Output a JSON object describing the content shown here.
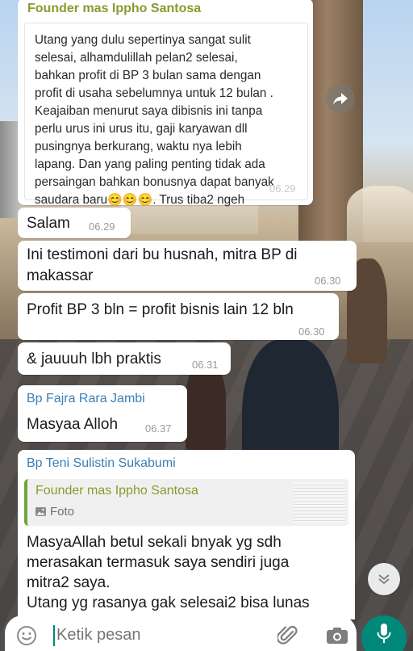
{
  "msg1": {
    "sender": "Founder mas Ippho Santosa",
    "lines": [
      "Utang yang dulu sepertinya sangat sulit",
      "selesai, alhamdulillah pelan2 selesai,",
      "bahkan profit di BP 3 bulan sama dengan",
      "profit di usaha sebelumnya untuk 12 bulan .",
      "Keajaiban menurut saya dibisnis ini tanpa",
      "perlu urus ini urus itu, gaji karyawan  dll",
      "pusingnya berkurang, waktu nya lebih",
      "lapang. Dan yang  paling penting  tidak ada",
      "persaingan bahkan bonusnya dapat banyak"
    ],
    "last_line_prefix": "saudara baru",
    "emoji": "😊😊😊",
    "last_line_suffix": ". Trus tiba2 ngeh",
    "time": "06.29"
  },
  "msg2": {
    "text": "Salam",
    "time": "06.29"
  },
  "msg3": {
    "line1": "Ini testimoni dari bu husnah, mitra BP di",
    "line2": "makassar",
    "time": "06.30"
  },
  "msg4": {
    "text": "Profit BP 3 bln = profit bisnis lain 12 bln",
    "time": "06.30"
  },
  "msg5": {
    "text": "& jauuuh lbh praktis",
    "time": "06.31"
  },
  "msg6": {
    "sender": "Bp Fajra Rara Jambi",
    "text": "Masyaa Alloh",
    "time": "06.37"
  },
  "msg7": {
    "sender": "Bp Teni Sulistin Sukabumi",
    "quote_sender": "Founder mas Ippho Santosa",
    "quote_type": "Foto",
    "lines": [
      "MasyaAllah betul sekali bnyak yg sdh",
      "merasakan termasuk saya sendiri juga",
      "mitra2 saya.",
      "Utang yg rasanya gak selesai2 bisa lunas"
    ]
  },
  "input": {
    "placeholder": "Ketik pesan"
  },
  "icons": {
    "emoji": "emoji-icon",
    "attach": "paperclip-icon",
    "camera": "camera-icon",
    "mic": "microphone-icon",
    "forward": "forward-icon",
    "scroll": "double-chevron-down-icon"
  },
  "colors": {
    "sender_green": "#8a9a2e",
    "sender_blue": "#3b7fb5",
    "quote_bar": "#6fa53a",
    "mic_bg": "#00897b"
  }
}
